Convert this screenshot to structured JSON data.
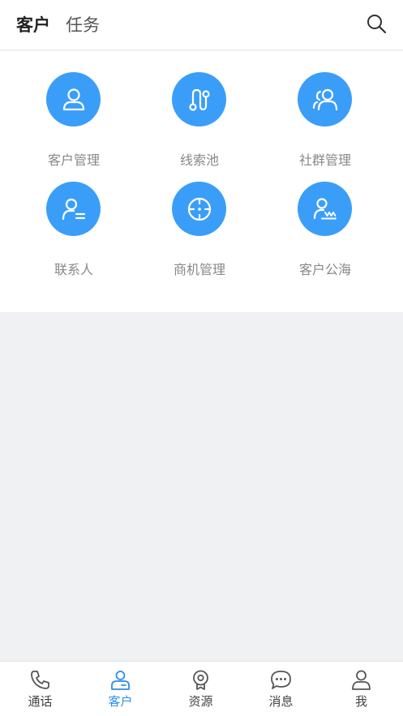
{
  "header": {
    "tabs": [
      {
        "label": "客户",
        "active": true
      },
      {
        "label": "任务",
        "active": false
      }
    ],
    "search_icon": "search-icon"
  },
  "grid": {
    "accent_color": "#3a9ef9",
    "items": [
      {
        "label": "客户管理",
        "icon": "user-icon"
      },
      {
        "label": "线索池",
        "icon": "route-icon"
      },
      {
        "label": "社群管理",
        "icon": "group-icon"
      },
      {
        "label": "联系人",
        "icon": "contact-icon"
      },
      {
        "label": "商机管理",
        "icon": "target-icon"
      },
      {
        "label": "客户公海",
        "icon": "user-wave-icon"
      }
    ]
  },
  "tabbar": {
    "active_color": "#2b8fe8",
    "items": [
      {
        "label": "通话",
        "icon": "phone-icon",
        "active": false
      },
      {
        "label": "客户",
        "icon": "customer-icon",
        "active": true
      },
      {
        "label": "资源",
        "icon": "resource-icon",
        "active": false
      },
      {
        "label": "消息",
        "icon": "message-icon",
        "active": false
      },
      {
        "label": "我",
        "icon": "profile-icon",
        "active": false
      }
    ]
  }
}
